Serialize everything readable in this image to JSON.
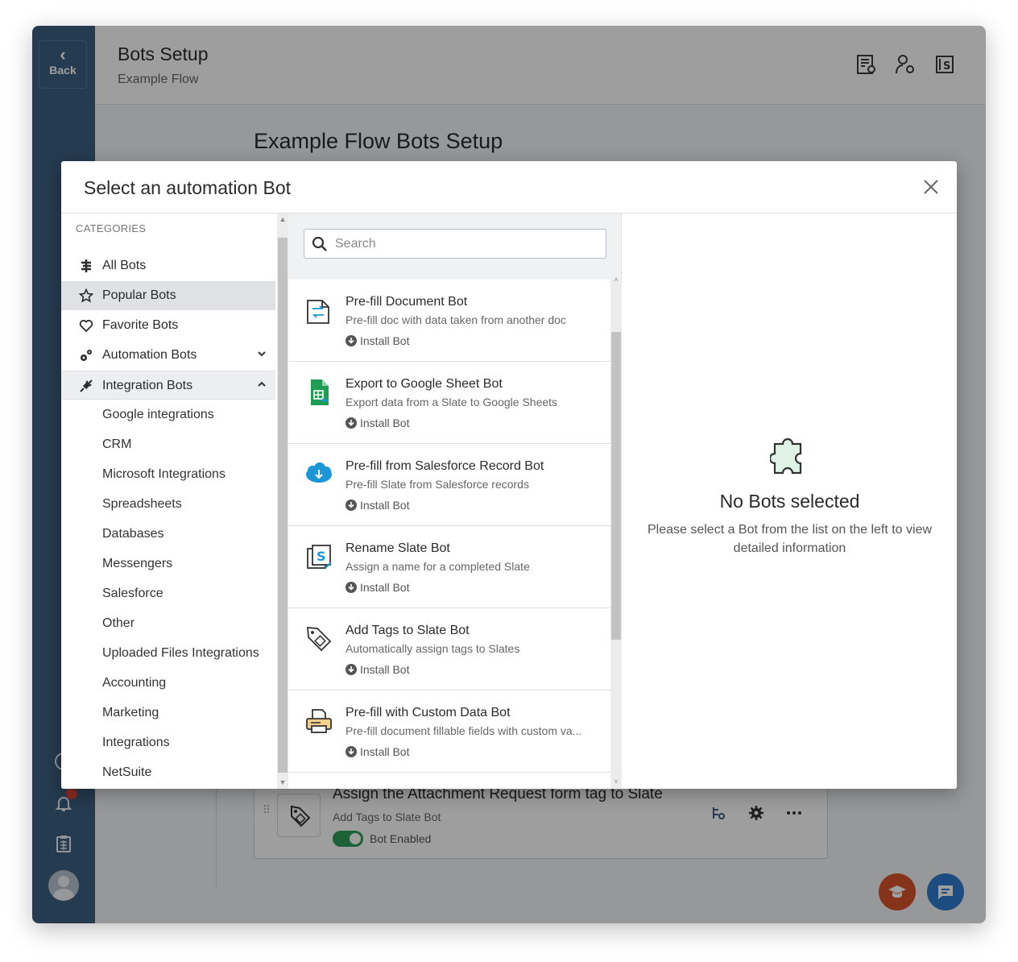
{
  "app": {
    "back_label": "Back",
    "title": "Bots Setup",
    "subtitle": "Example Flow"
  },
  "page": {
    "title": "Example Flow Bots Setup"
  },
  "background_bot": {
    "title": "Assign the Attachment Request form tag to Slate",
    "subtitle": "Add Tags to Slate Bot",
    "status": "Bot Enabled",
    "enabled": true
  },
  "modal": {
    "title": "Select an automation Bot",
    "categories_label": "CATEGORIES",
    "categories": [
      {
        "label": "All Bots",
        "icon": "bots-icon"
      },
      {
        "label": "Popular Bots",
        "icon": "star-icon",
        "selected": true
      },
      {
        "label": "Favorite Bots",
        "icon": "heart-icon"
      },
      {
        "label": "Automation Bots",
        "icon": "gears-icon",
        "caret": "down"
      },
      {
        "label": "Integration Bots",
        "icon": "plug-icon",
        "caret": "up"
      }
    ],
    "subcategories": [
      "Google integrations",
      "CRM",
      "Microsoft Integrations",
      "Spreadsheets",
      "Databases",
      "Messengers",
      "Salesforce",
      "Other",
      "Uploaded Files Integrations",
      "Accounting",
      "Marketing",
      "Integrations",
      "NetSuite"
    ],
    "search": {
      "placeholder": "Search",
      "value": ""
    },
    "install_label": "Install Bot",
    "bots": [
      {
        "title": "Pre-fill Document Bot",
        "desc": "Pre-fill doc with data taken from another doc",
        "icon": "document-transfer-icon"
      },
      {
        "title": "Export to Google Sheet Bot",
        "desc": "Export data from a Slate to Google Sheets",
        "icon": "google-sheets-icon"
      },
      {
        "title": "Pre-fill from Salesforce Record Bot",
        "desc": "Pre-fill Slate from Salesforce records",
        "icon": "salesforce-cloud-icon"
      },
      {
        "title": "Rename Slate Bot",
        "desc": "Assign a name for a completed Slate",
        "icon": "rename-slate-icon"
      },
      {
        "title": "Add Tags to Slate Bot",
        "desc": "Automatically assign tags to Slates",
        "icon": "tag-icon"
      },
      {
        "title": "Pre-fill with Custom Data Bot",
        "desc": "Pre-fill document fillable fields with custom va...",
        "icon": "printer-icon"
      }
    ],
    "detail": {
      "title": "No Bots selected",
      "text": "Please select a Bot from the list on the left to view detailed information"
    }
  },
  "colors": {
    "rail": "#3d5f80",
    "toggle_on": "#2e9d5a",
    "fab_academy": "#d9532c",
    "fab_chat": "#2f7bd1",
    "salesforce": "#1b96d6",
    "sheets": "#1f9d55"
  }
}
